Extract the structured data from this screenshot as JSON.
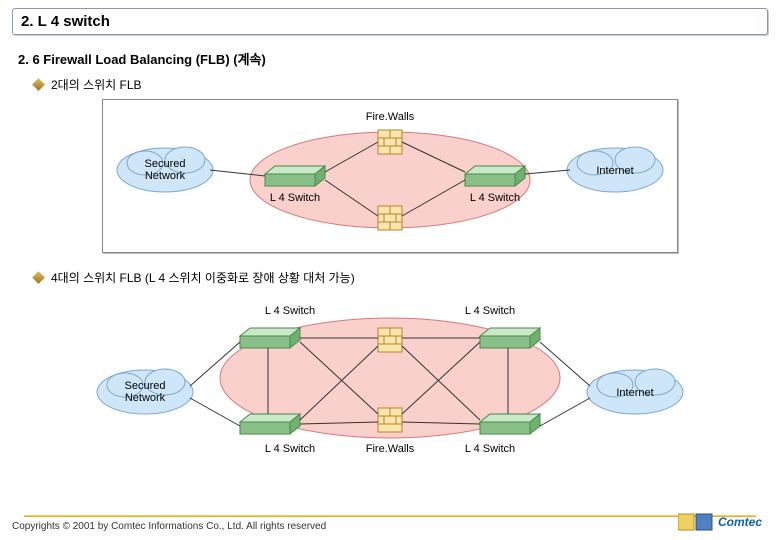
{
  "header": {
    "main_title": "2. L 4 switch"
  },
  "subtitle": "2. 6 Firewall  Load Balancing (FLB) (계속)",
  "bullets": [
    {
      "text": "2대의 스위치 FLB"
    },
    {
      "text": "4대의 스위치 FLB (L 4 스위치 이중화로 장애 상황 대처 가능)"
    }
  ],
  "diagram1": {
    "firewalls_label": "Fire.Walls",
    "secured_label": "Secured\nNetwork",
    "internet_label": "Internet",
    "l4_left": "L 4 Switch",
    "l4_right": "L 4 Switch"
  },
  "diagram2": {
    "tl": "L 4 Switch",
    "tr": "L 4 Switch",
    "bl": "L 4 Switch",
    "br": "L 4 Switch",
    "secured_label": "Secured\nNetwork",
    "internet_label": "Internet",
    "firewalls_label": "Fire.Walls"
  },
  "footer": {
    "copyright": "Copyrights © 2001 by Comtec Informations Co., Ltd. All rights reserved"
  },
  "logo_text": "Comtec",
  "colors": {
    "ellipse_fill": "#f9d0cc",
    "ellipse_stroke": "#d87878",
    "cloud_fill": "#cfe6f8",
    "firewall_fill": "#f8e6b0",
    "firewall_stroke": "#c08020",
    "switch_top": "#c8e8c8",
    "switch_side": "#70b070",
    "switch_front": "#88c088"
  }
}
